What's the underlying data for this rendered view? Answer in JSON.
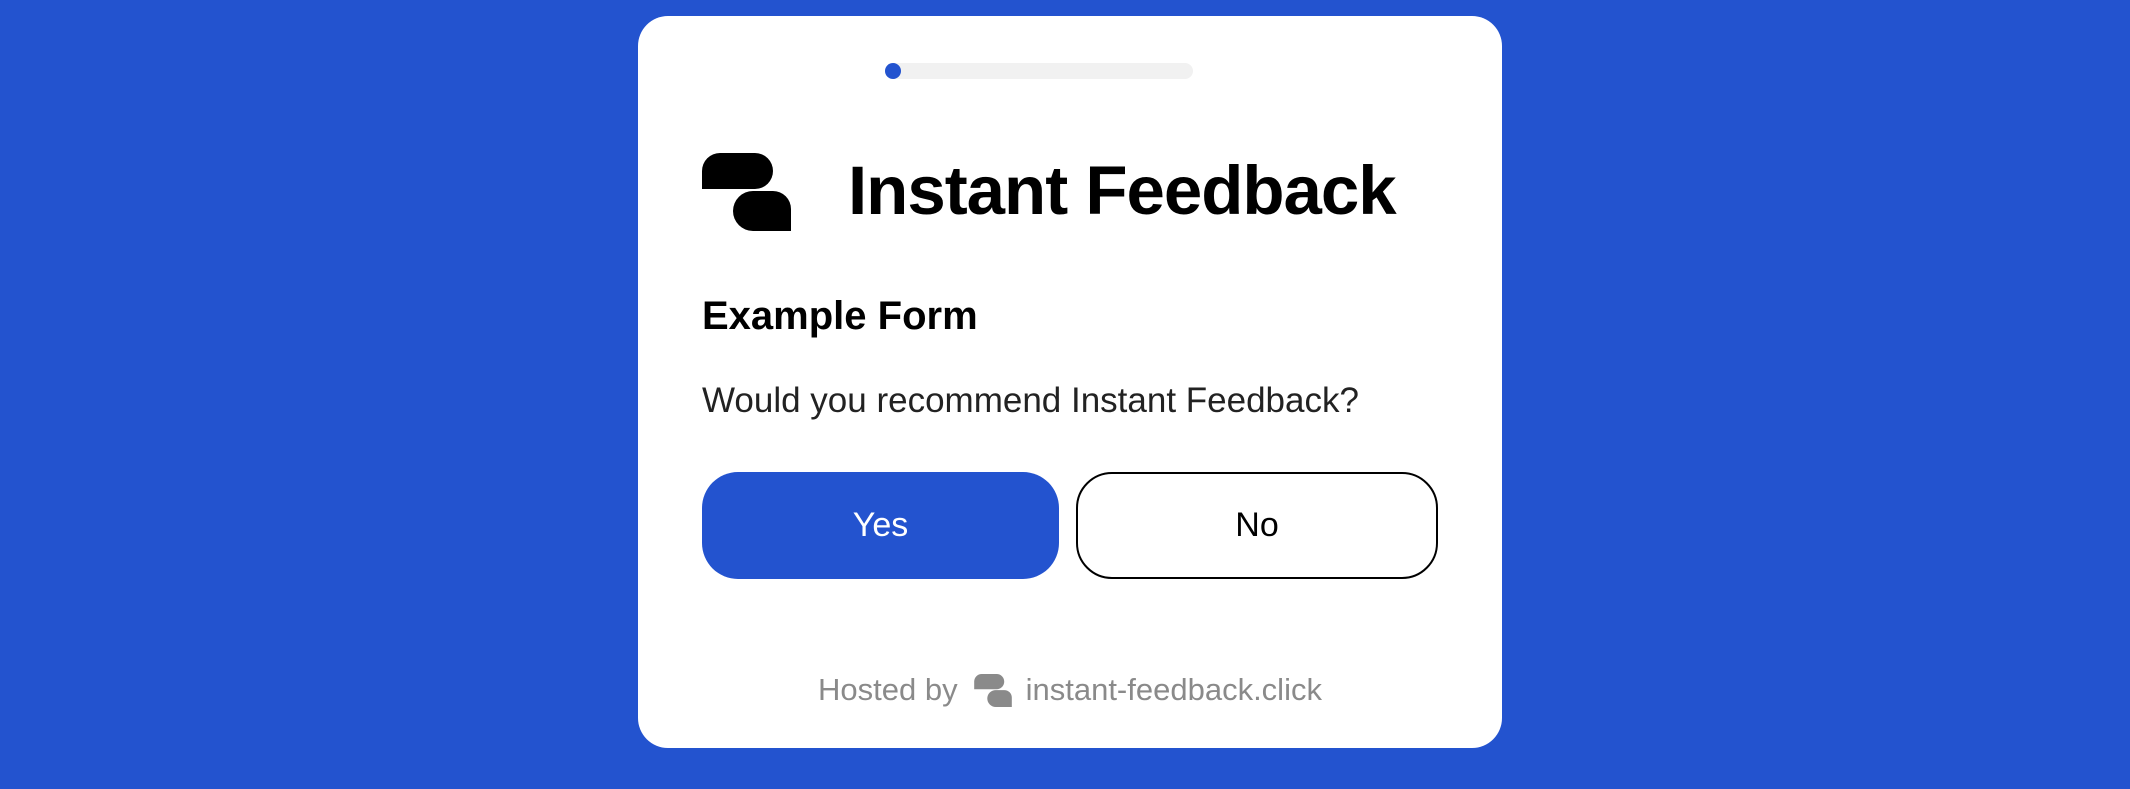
{
  "colors": {
    "background": "#2353CF",
    "card": "#FFFFFF",
    "accent": "#2353CF",
    "footer_text": "#8A8A8A"
  },
  "progress": {
    "value": 0.0
  },
  "brand": {
    "name": "Instant Feedback",
    "logo_icon": "chat-bubbles-logo-icon"
  },
  "form": {
    "title": "Example Form",
    "question": "Would you recommend Instant Feedback?",
    "options": {
      "yes_label": "Yes",
      "no_label": "No"
    }
  },
  "footer": {
    "hosted_by_label": "Hosted by",
    "logo_icon": "chat-bubbles-logo-icon",
    "link_text": "instant-feedback.click"
  }
}
